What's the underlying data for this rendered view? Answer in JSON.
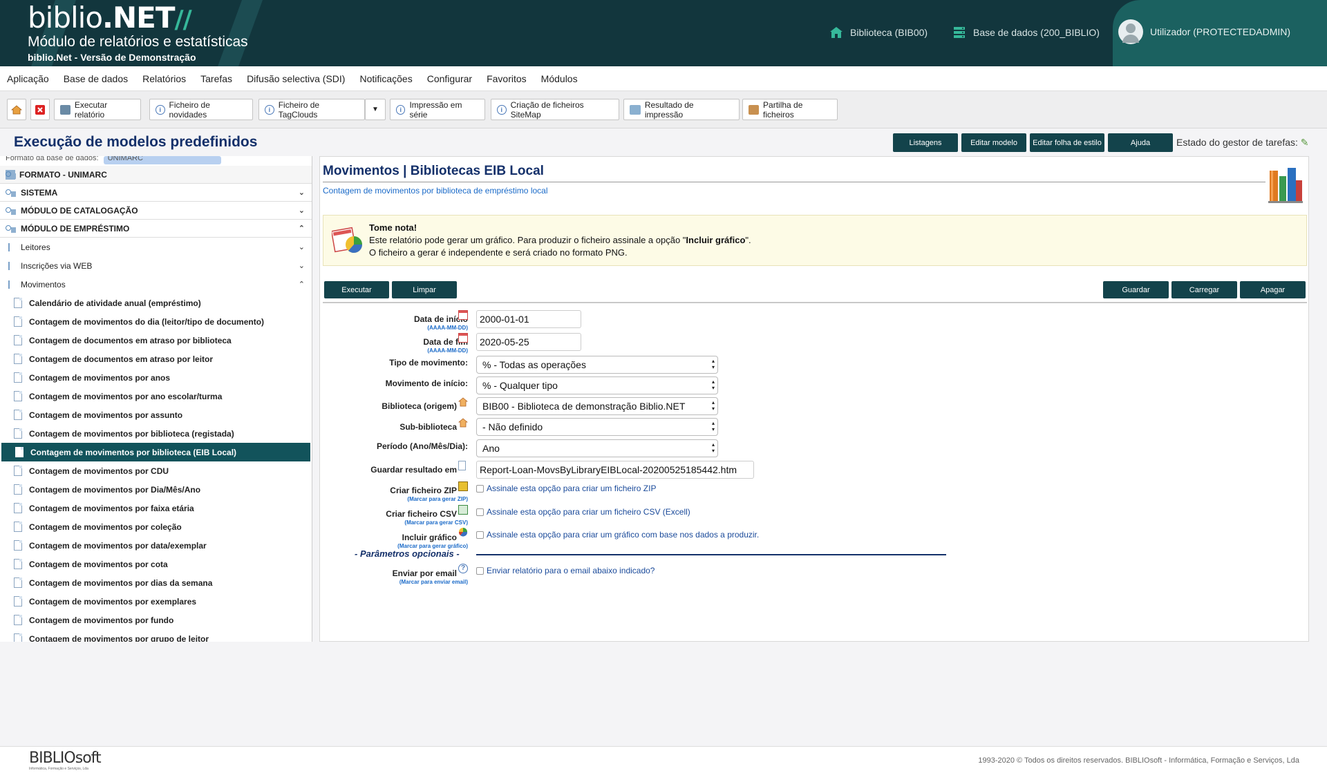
{
  "header": {
    "logo_main": "biblio",
    "logo_net": ".NET",
    "logo_slash": "//",
    "subtitle": "Módulo de relatórios e estatísticas",
    "subtitle2": "biblio.Net - Versão de Demonstração",
    "library": "Biblioteca (BIB00)",
    "database": "Base de dados (200_BIBLIO)",
    "user": "Utilizador (PROTECTEDADMIN)"
  },
  "menu": [
    "Aplicação",
    "Base de dados",
    "Relatórios",
    "Tarefas",
    "Difusão selectiva (SDI)",
    "Notificações",
    "Configurar",
    "Favoritos",
    "Módulos"
  ],
  "toolbar": {
    "execute": "Executar relatório",
    "news": "Ficheiro de novidades",
    "tagclouds": "Ficheiro de TagClouds",
    "dropdown": "▼",
    "serial": "Impressão em série",
    "sitemap": "Criação de ficheiros SiteMap",
    "print_result": "Resultado de impressão",
    "share": "Partilha de ficheiros"
  },
  "titlebar": {
    "title": "Execução de modelos predefinidos",
    "btn_listings": "Listagens",
    "btn_edit_model": "Editar modelo",
    "btn_edit_style": "Editar folha de estilo",
    "btn_help": "Ajuda",
    "task_state": "Estado do gestor de tarefas:"
  },
  "sidebar": {
    "top_label": "Formato da base de dados:",
    "top_value": "UNIMARC",
    "sections": [
      {
        "label": "FORMATO - UNIMARC",
        "chevron": ""
      },
      {
        "label": "SISTEMA",
        "chevron": "⌄"
      },
      {
        "label": "MÓDULO DE CATALOGAÇÃO",
        "chevron": "⌄"
      },
      {
        "label": "MÓDULO DE EMPRÉSTIMO",
        "chevron": "⌃"
      }
    ],
    "subs": [
      {
        "label": "Leitores",
        "chevron": "⌄"
      },
      {
        "label": "Inscrições via WEB",
        "chevron": "⌄"
      },
      {
        "label": "Movimentos",
        "chevron": "⌃"
      }
    ],
    "reports": [
      "Calendário de atividade anual (empréstimo)",
      "Contagem de movimentos do dia (leitor/tipo de documento)",
      "Contagem de documentos em atraso por biblioteca",
      "Contagem de documentos em atraso por leitor",
      "Contagem de movimentos por anos",
      "Contagem de movimentos por ano escolar/turma",
      "Contagem de movimentos por assunto",
      "Contagem de movimentos por biblioteca (registada)",
      "Contagem de movimentos por biblioteca (EIB Local)",
      "Contagem de movimentos por CDU",
      "Contagem de movimentos por Dia/Mês/Ano",
      "Contagem de movimentos por faixa etária",
      "Contagem de movimentos por coleção",
      "Contagem de movimentos por data/exemplar",
      "Contagem de movimentos por cota",
      "Contagem de movimentos por dias da semana",
      "Contagem de movimentos por exemplares",
      "Contagem de movimentos por fundo",
      "Contagem de movimentos por grupo de leitor"
    ]
  },
  "main": {
    "title": "Movimentos | Bibliotecas EIB Local",
    "subtitle": "Contagem de movimentos por biblioteca de empréstimo local",
    "note_title": "Tome nota!",
    "note_line1a": "Este relatório pode gerar um gráfico. Para produzir o ficheiro assinale a opção \"",
    "note_line1b": "Incluir gráfico",
    "note_line1c": "\".",
    "note_line2": "O ficheiro a gerar é independente e será criado no formato PNG.",
    "btn_execute": "Executar",
    "btn_clear": "Limpar",
    "btn_save": "Guardar",
    "btn_load": "Carregar",
    "btn_delete": "Apagar",
    "form": {
      "start_label": "Data de início",
      "start_hint": "(AAAA-MM-DD)",
      "start_value": "2000-01-01",
      "end_label": "Data de fim",
      "end_hint": "(AAAA-MM-DD)",
      "end_value": "2020-05-25",
      "type_label": "Tipo de movimento:",
      "type_value": "% - Todas as operações",
      "start_move_label": "Movimento de início:",
      "start_move_value": "% - Qualquer tipo",
      "library_label": "Biblioteca (origem)",
      "library_value": "BIB00 - Biblioteca de demonstração Biblio.NET",
      "sublib_label": "Sub-biblioteca",
      "sublib_value": "- Não definido",
      "period_label": "Período (Ano/Mês/Dia):",
      "period_value": "Ano",
      "save_label": "Guardar resultado em",
      "save_value": "Report-Loan-MovsByLibraryEIBLocal-20200525185442.htm",
      "zip_label": "Criar ficheiro ZIP",
      "zip_hint": "(Marcar para gerar ZIP)",
      "zip_text": "Assinale esta opção para criar um ficheiro ZIP",
      "csv_label": "Criar ficheiro CSV",
      "csv_hint": "(Marcar para gerar CSV)",
      "csv_text": "Assinale esta opção para criar um ficheiro CSV (Excell)",
      "chart_label": "Incluir gráfico",
      "chart_hint": "(Marcar para gerar gráfico)",
      "chart_text": "Assinale esta opção para criar um gráfico com base nos dados a produzir.",
      "optional_title": "- Parâmetros opcionais -",
      "email_label": "Enviar por email",
      "email_hint": "(Marcar para enviar email)",
      "email_text": "Enviar relatório para o email abaixo indicado?"
    }
  },
  "footer": {
    "logo": "BIBLIOsoft",
    "logo_sub": "Informática, Formação e Serviços, Lda",
    "copyright": "1993-2020 © Todos os direitos reservados. BIBLIOsoft - Informática, Formação e Serviços, Lda"
  },
  "colors": {
    "header_bg": "#12363d",
    "accent": "#13434b",
    "title_blue": "#14306a",
    "link_blue": "#1a6ac8"
  }
}
